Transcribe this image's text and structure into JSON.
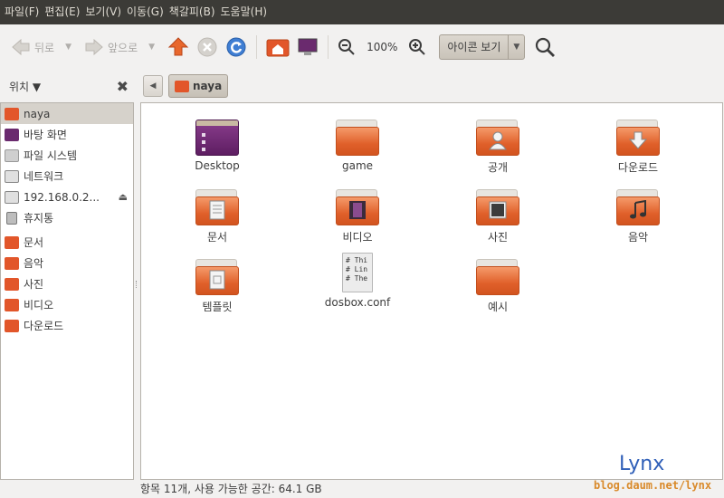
{
  "menubar": {
    "items": [
      "파일(F)",
      "편집(E)",
      "보기(V)",
      "이동(G)",
      "책갈피(B)",
      "도움말(H)"
    ]
  },
  "toolbar": {
    "back_label": "뒤로",
    "forward_label": "앞으로",
    "zoom_level": "100%",
    "view_mode": "아이콘 보기"
  },
  "side_pane": {
    "title": "위치",
    "places": [
      {
        "label": "naya",
        "icon": "home-folder-icon",
        "selected": true,
        "color": "#e2562a"
      },
      {
        "label": "바탕 화면",
        "icon": "desktop-icon",
        "color": "#6a2a6e"
      },
      {
        "label": "파일 시스템",
        "icon": "drive-icon",
        "color": "#9a9a9a"
      },
      {
        "label": "네트워크",
        "icon": "network-icon",
        "color": "#7a7a7a"
      },
      {
        "label": "192.168.0.2...",
        "icon": "network-share-icon",
        "color": "#7a7a7a",
        "ejectable": true
      },
      {
        "label": "휴지통",
        "icon": "trash-icon",
        "color": "#8a8a8a"
      }
    ],
    "bookmarks": [
      {
        "label": "문서",
        "icon": "documents-folder-icon",
        "color": "#e2562a"
      },
      {
        "label": "음악",
        "icon": "music-folder-icon",
        "color": "#e2562a"
      },
      {
        "label": "사진",
        "icon": "pictures-folder-icon",
        "color": "#e2562a"
      },
      {
        "label": "비디오",
        "icon": "videos-folder-icon",
        "color": "#e2562a"
      },
      {
        "label": "다운로드",
        "icon": "downloads-folder-icon",
        "color": "#e2562a"
      }
    ]
  },
  "pathbar": {
    "current": "naya"
  },
  "files": [
    {
      "label": "Desktop",
      "kind": "desktop"
    },
    {
      "label": "game",
      "kind": "folder"
    },
    {
      "label": "공개",
      "kind": "folder",
      "emblem": "person"
    },
    {
      "label": "다운로드",
      "kind": "folder",
      "emblem": "download"
    },
    {
      "label": "문서",
      "kind": "folder",
      "emblem": "document"
    },
    {
      "label": "비디오",
      "kind": "folder",
      "emblem": "film"
    },
    {
      "label": "사진",
      "kind": "folder",
      "emblem": "photo"
    },
    {
      "label": "음악",
      "kind": "folder",
      "emblem": "music"
    },
    {
      "label": "템플릿",
      "kind": "folder",
      "emblem": "template"
    },
    {
      "label": "dosbox.conf",
      "kind": "text",
      "preview": "# Thi\n# Lin\n# The"
    },
    {
      "label": "예시",
      "kind": "folder"
    }
  ],
  "statusbar": {
    "text": "항목 11개, 사용 가능한 공간: 64.1 GB"
  },
  "watermark": {
    "name": "Lynx",
    "url": "blog.daum.net/lynx"
  }
}
